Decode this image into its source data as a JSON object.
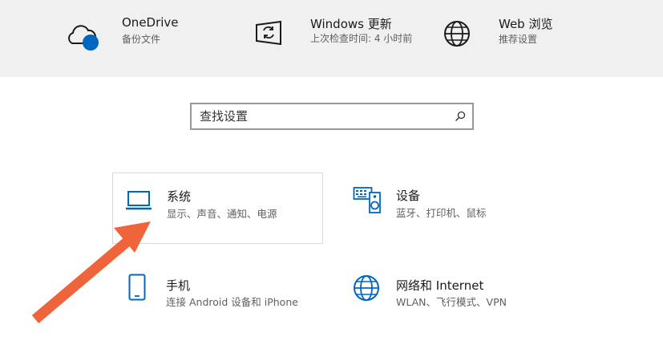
{
  "top": {
    "onedrive": {
      "title": "OneDrive",
      "subtitle": "备份文件",
      "icon": "onedrive-cloud-icon"
    },
    "windows_update": {
      "title": "Windows 更新",
      "subtitle": "上次检查时间: 4 小时前",
      "icon": "windows-update-icon"
    },
    "web_browse": {
      "title": "Web 浏览",
      "subtitle": "推荐设置",
      "icon": "globe-icon"
    }
  },
  "search": {
    "placeholder": "查找设置",
    "icon": "search-icon"
  },
  "tiles": [
    {
      "id": "system",
      "title": "系统",
      "subtitle": "显示、声音、通知、电源",
      "icon": "laptop-icon",
      "highlighted": true
    },
    {
      "id": "devices",
      "title": "设备",
      "subtitle": "蓝牙、打印机、鼠标",
      "icon": "keyboard-speaker-icon"
    },
    {
      "id": "phone",
      "title": "手机",
      "subtitle": "连接 Android 设备和 iPhone",
      "icon": "phone-icon"
    },
    {
      "id": "network",
      "title": "网络和 Internet",
      "subtitle": "WLAN、飞行模式、VPN",
      "icon": "globe-icon"
    }
  ],
  "colors": {
    "accent": "#0067c0",
    "arrow": "#f0643c",
    "topbar": "#f0f0f0"
  }
}
